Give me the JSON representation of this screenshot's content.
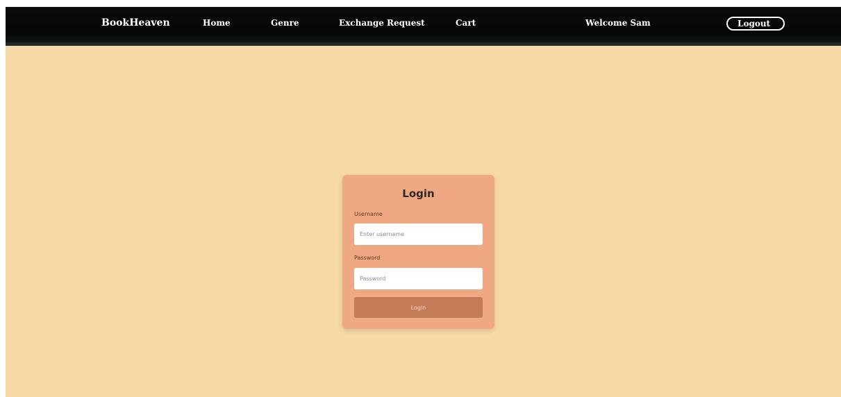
{
  "navbar": {
    "brand": "BookHeaven",
    "links": [
      "Home",
      "Genre",
      "Exchange Request",
      "Cart"
    ],
    "welcome": "Welcome Sam",
    "logout_label": "Logout"
  },
  "login": {
    "title": "Login",
    "username_label": "Username",
    "username_placeholder": "Enter username",
    "password_label": "Password",
    "password_placeholder": "Password",
    "submit_label": "Login"
  },
  "colors": {
    "page_background": "#f6d9a5",
    "navbar_background": "#050505",
    "card_background": "#f0a882",
    "button_background": "#c57a58"
  }
}
